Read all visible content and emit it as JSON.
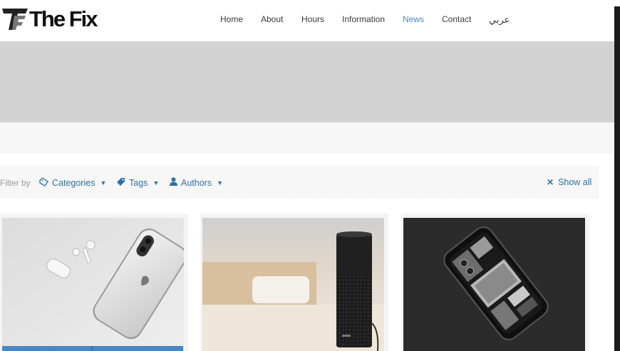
{
  "brand": {
    "name": "The Fix"
  },
  "nav": {
    "items": [
      {
        "label": "Home"
      },
      {
        "label": "About"
      },
      {
        "label": "Hours"
      },
      {
        "label": "Information"
      },
      {
        "label": "News",
        "active": true
      },
      {
        "label": "Contact"
      },
      {
        "label": "عربي"
      }
    ]
  },
  "filters": {
    "label": "Filter by",
    "categories": "Categories",
    "tags": "Tags",
    "authors": "Authors",
    "show_all": "Show all"
  },
  "posts": [
    {
      "image": "iphone-and-airpods-photo"
    },
    {
      "image": "smart-speaker-photo"
    },
    {
      "image": "transparent-phone-photo"
    }
  ],
  "colors": {
    "accent": "#4b8ac3",
    "link": "#2f70a8",
    "banner": "#d3d3d3"
  }
}
